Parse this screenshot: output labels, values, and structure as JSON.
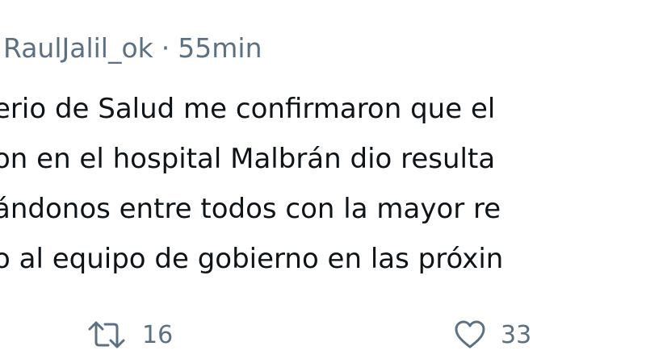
{
  "tweet": {
    "handle": "RaulJalil_ok",
    "separator": "·",
    "time": "55min",
    "lines": [
      "erio de Salud me confirmaron que el",
      "on en el hospital Malbrán dio resulta",
      "ándonos entre todos con la mayor re",
      "o al equipo de gobierno en las próxin"
    ]
  },
  "actions": {
    "retweet": {
      "icon": "retweet-icon",
      "count": "16"
    },
    "like": {
      "icon": "heart-icon",
      "count": "33"
    }
  },
  "colors": {
    "text": "#0f1419",
    "secondary": "#5b7083",
    "background": "#ffffff"
  }
}
